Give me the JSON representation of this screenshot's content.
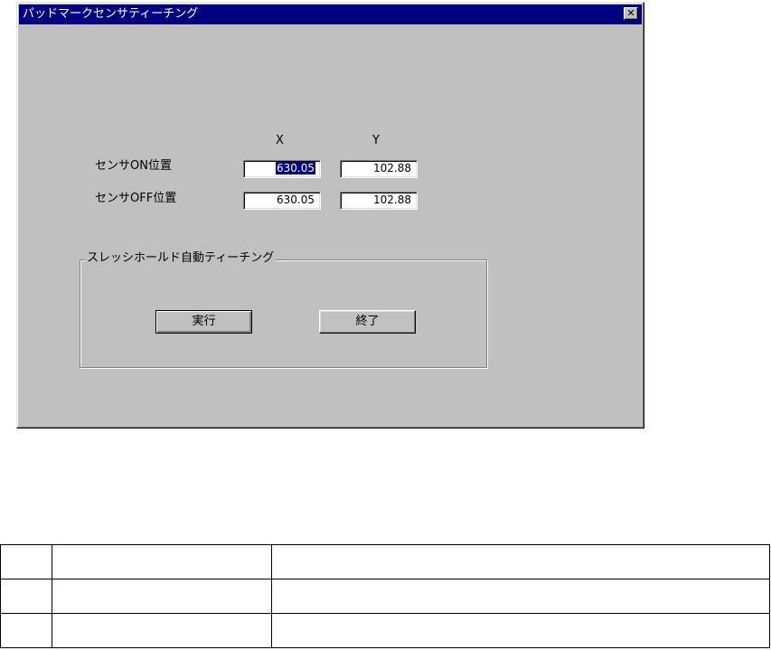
{
  "window": {
    "title": "パッドマークセンサティーチング",
    "close_glyph": "✕"
  },
  "columns": {
    "x_label": "X",
    "y_label": "Y"
  },
  "rows": [
    {
      "label": "センサON位置",
      "x_value": "630.05",
      "y_value": "102.88"
    },
    {
      "label": "センサOFF位置",
      "x_value": "630.05",
      "y_value": "102.88"
    }
  ],
  "group": {
    "title": "スレッシホールド自動ティーチング",
    "execute_label": "実行",
    "exit_label": "終了"
  },
  "table": {
    "rows": [
      [
        "",
        "",
        ""
      ],
      [
        "",
        "",
        ""
      ],
      [
        "",
        "",
        ""
      ]
    ]
  },
  "colors": {
    "titlebar": "#000080",
    "dialog_face": "#c0c0c0",
    "selection": "#000080"
  },
  "icons": {
    "close": "close-icon"
  }
}
